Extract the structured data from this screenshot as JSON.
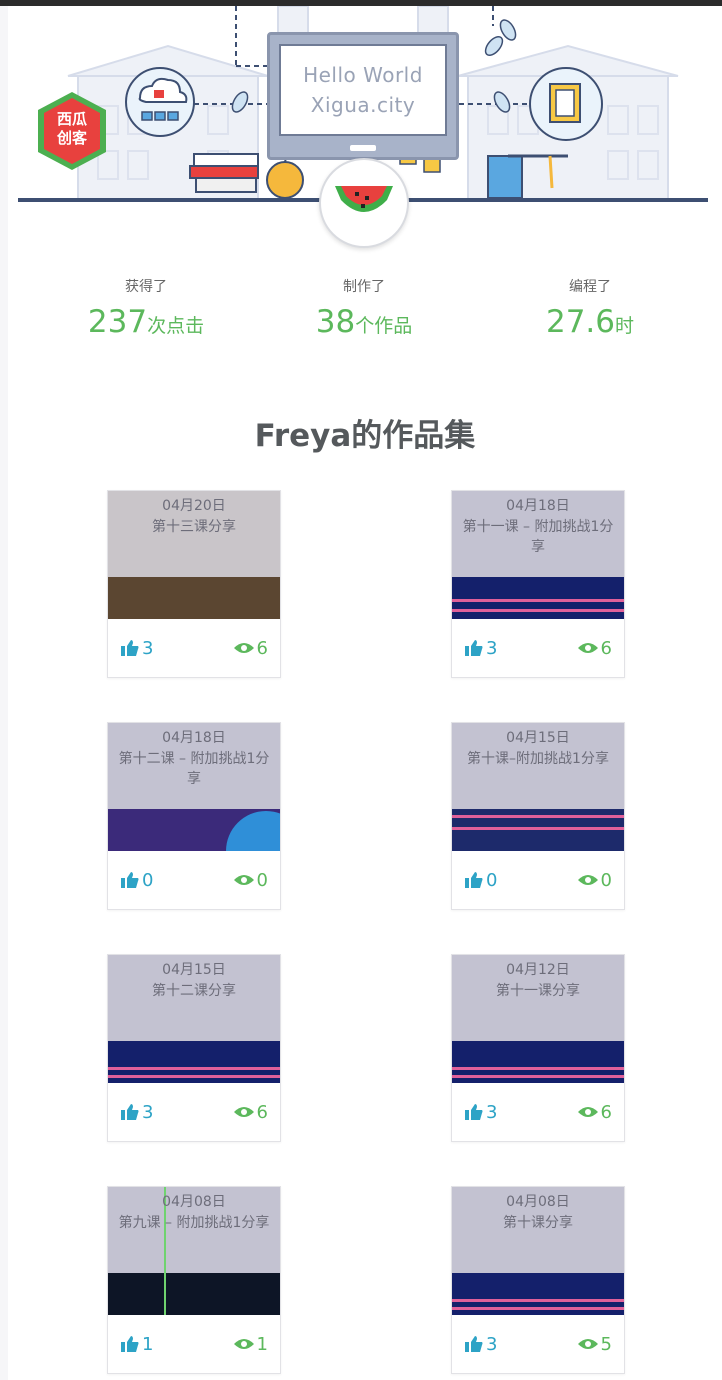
{
  "header": {
    "monitor_line1": "Hello World",
    "monitor_line2": "Xigua.city",
    "logo_line1": "西瓜",
    "logo_line2": "创客"
  },
  "stats": [
    {
      "label": "获得了",
      "value": "237",
      "unit": "次点击"
    },
    {
      "label": "制作了",
      "value": "38",
      "unit": "个作品"
    },
    {
      "label": "编程了",
      "value": "27.6",
      "unit": "时"
    }
  ],
  "gallery": {
    "title": "Freya的作品集",
    "works": [
      {
        "date": "04月20日",
        "title": "第十三课分享",
        "likes": "3",
        "views": "6"
      },
      {
        "date": "04月18日",
        "title": "第十一课 – 附加挑战1分享",
        "likes": "3",
        "views": "6"
      },
      {
        "date": "04月18日",
        "title": "第十二课 – 附加挑战1分享",
        "likes": "0",
        "views": "0"
      },
      {
        "date": "04月15日",
        "title": "第十课–附加挑战1分享",
        "likes": "0",
        "views": "0"
      },
      {
        "date": "04月15日",
        "title": "第十二课分享",
        "likes": "3",
        "views": "6"
      },
      {
        "date": "04月12日",
        "title": "第十一课分享",
        "likes": "3",
        "views": "6"
      },
      {
        "date": "04月08日",
        "title": "第九课 – 附加挑战1分享",
        "likes": "1",
        "views": "1"
      },
      {
        "date": "04月08日",
        "title": "第十课分享",
        "likes": "3",
        "views": "5"
      }
    ]
  },
  "colors": {
    "accent_green": "#5cb85c",
    "like_blue": "#2da3c6",
    "logo_red": "#e8413e",
    "logo_green": "#4caf50"
  },
  "icons": {
    "like": "thumbs-up-icon",
    "view": "eye-icon",
    "avatar": "watermelon-icon"
  }
}
